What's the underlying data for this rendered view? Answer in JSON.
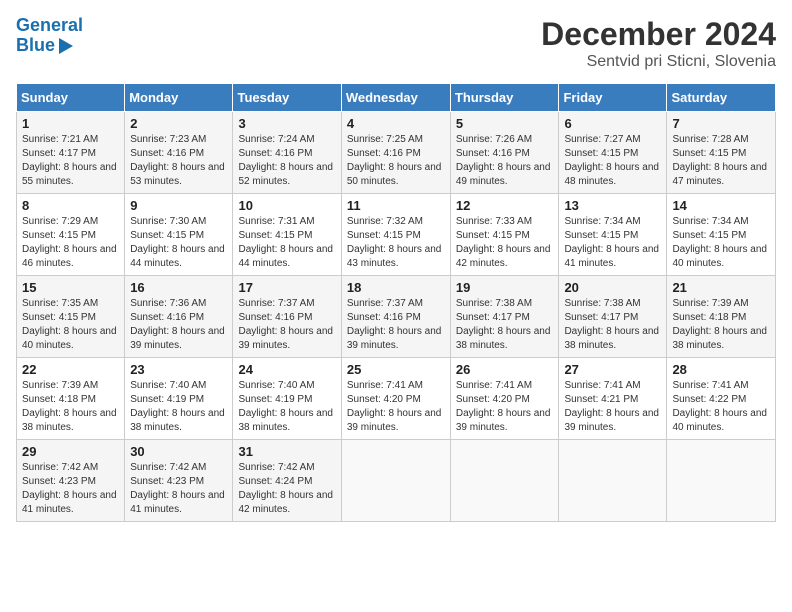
{
  "header": {
    "logo_line1": "General",
    "logo_line2": "Blue",
    "title": "December 2024",
    "subtitle": "Sentvid pri Sticni, Slovenia"
  },
  "weekdays": [
    "Sunday",
    "Monday",
    "Tuesday",
    "Wednesday",
    "Thursday",
    "Friday",
    "Saturday"
  ],
  "weeks": [
    [
      {
        "day": "1",
        "sunrise": "Sunrise: 7:21 AM",
        "sunset": "Sunset: 4:17 PM",
        "daylight": "Daylight: 8 hours and 55 minutes."
      },
      {
        "day": "2",
        "sunrise": "Sunrise: 7:23 AM",
        "sunset": "Sunset: 4:16 PM",
        "daylight": "Daylight: 8 hours and 53 minutes."
      },
      {
        "day": "3",
        "sunrise": "Sunrise: 7:24 AM",
        "sunset": "Sunset: 4:16 PM",
        "daylight": "Daylight: 8 hours and 52 minutes."
      },
      {
        "day": "4",
        "sunrise": "Sunrise: 7:25 AM",
        "sunset": "Sunset: 4:16 PM",
        "daylight": "Daylight: 8 hours and 50 minutes."
      },
      {
        "day": "5",
        "sunrise": "Sunrise: 7:26 AM",
        "sunset": "Sunset: 4:16 PM",
        "daylight": "Daylight: 8 hours and 49 minutes."
      },
      {
        "day": "6",
        "sunrise": "Sunrise: 7:27 AM",
        "sunset": "Sunset: 4:15 PM",
        "daylight": "Daylight: 8 hours and 48 minutes."
      },
      {
        "day": "7",
        "sunrise": "Sunrise: 7:28 AM",
        "sunset": "Sunset: 4:15 PM",
        "daylight": "Daylight: 8 hours and 47 minutes."
      }
    ],
    [
      {
        "day": "8",
        "sunrise": "Sunrise: 7:29 AM",
        "sunset": "Sunset: 4:15 PM",
        "daylight": "Daylight: 8 hours and 46 minutes."
      },
      {
        "day": "9",
        "sunrise": "Sunrise: 7:30 AM",
        "sunset": "Sunset: 4:15 PM",
        "daylight": "Daylight: 8 hours and 44 minutes."
      },
      {
        "day": "10",
        "sunrise": "Sunrise: 7:31 AM",
        "sunset": "Sunset: 4:15 PM",
        "daylight": "Daylight: 8 hours and 44 minutes."
      },
      {
        "day": "11",
        "sunrise": "Sunrise: 7:32 AM",
        "sunset": "Sunset: 4:15 PM",
        "daylight": "Daylight: 8 hours and 43 minutes."
      },
      {
        "day": "12",
        "sunrise": "Sunrise: 7:33 AM",
        "sunset": "Sunset: 4:15 PM",
        "daylight": "Daylight: 8 hours and 42 minutes."
      },
      {
        "day": "13",
        "sunrise": "Sunrise: 7:34 AM",
        "sunset": "Sunset: 4:15 PM",
        "daylight": "Daylight: 8 hours and 41 minutes."
      },
      {
        "day": "14",
        "sunrise": "Sunrise: 7:34 AM",
        "sunset": "Sunset: 4:15 PM",
        "daylight": "Daylight: 8 hours and 40 minutes."
      }
    ],
    [
      {
        "day": "15",
        "sunrise": "Sunrise: 7:35 AM",
        "sunset": "Sunset: 4:15 PM",
        "daylight": "Daylight: 8 hours and 40 minutes."
      },
      {
        "day": "16",
        "sunrise": "Sunrise: 7:36 AM",
        "sunset": "Sunset: 4:16 PM",
        "daylight": "Daylight: 8 hours and 39 minutes."
      },
      {
        "day": "17",
        "sunrise": "Sunrise: 7:37 AM",
        "sunset": "Sunset: 4:16 PM",
        "daylight": "Daylight: 8 hours and 39 minutes."
      },
      {
        "day": "18",
        "sunrise": "Sunrise: 7:37 AM",
        "sunset": "Sunset: 4:16 PM",
        "daylight": "Daylight: 8 hours and 39 minutes."
      },
      {
        "day": "19",
        "sunrise": "Sunrise: 7:38 AM",
        "sunset": "Sunset: 4:17 PM",
        "daylight": "Daylight: 8 hours and 38 minutes."
      },
      {
        "day": "20",
        "sunrise": "Sunrise: 7:38 AM",
        "sunset": "Sunset: 4:17 PM",
        "daylight": "Daylight: 8 hours and 38 minutes."
      },
      {
        "day": "21",
        "sunrise": "Sunrise: 7:39 AM",
        "sunset": "Sunset: 4:18 PM",
        "daylight": "Daylight: 8 hours and 38 minutes."
      }
    ],
    [
      {
        "day": "22",
        "sunrise": "Sunrise: 7:39 AM",
        "sunset": "Sunset: 4:18 PM",
        "daylight": "Daylight: 8 hours and 38 minutes."
      },
      {
        "day": "23",
        "sunrise": "Sunrise: 7:40 AM",
        "sunset": "Sunset: 4:19 PM",
        "daylight": "Daylight: 8 hours and 38 minutes."
      },
      {
        "day": "24",
        "sunrise": "Sunrise: 7:40 AM",
        "sunset": "Sunset: 4:19 PM",
        "daylight": "Daylight: 8 hours and 38 minutes."
      },
      {
        "day": "25",
        "sunrise": "Sunrise: 7:41 AM",
        "sunset": "Sunset: 4:20 PM",
        "daylight": "Daylight: 8 hours and 39 minutes."
      },
      {
        "day": "26",
        "sunrise": "Sunrise: 7:41 AM",
        "sunset": "Sunset: 4:20 PM",
        "daylight": "Daylight: 8 hours and 39 minutes."
      },
      {
        "day": "27",
        "sunrise": "Sunrise: 7:41 AM",
        "sunset": "Sunset: 4:21 PM",
        "daylight": "Daylight: 8 hours and 39 minutes."
      },
      {
        "day": "28",
        "sunrise": "Sunrise: 7:41 AM",
        "sunset": "Sunset: 4:22 PM",
        "daylight": "Daylight: 8 hours and 40 minutes."
      }
    ],
    [
      {
        "day": "29",
        "sunrise": "Sunrise: 7:42 AM",
        "sunset": "Sunset: 4:23 PM",
        "daylight": "Daylight: 8 hours and 41 minutes."
      },
      {
        "day": "30",
        "sunrise": "Sunrise: 7:42 AM",
        "sunset": "Sunset: 4:23 PM",
        "daylight": "Daylight: 8 hours and 41 minutes."
      },
      {
        "day": "31",
        "sunrise": "Sunrise: 7:42 AM",
        "sunset": "Sunset: 4:24 PM",
        "daylight": "Daylight: 8 hours and 42 minutes."
      },
      null,
      null,
      null,
      null
    ]
  ]
}
